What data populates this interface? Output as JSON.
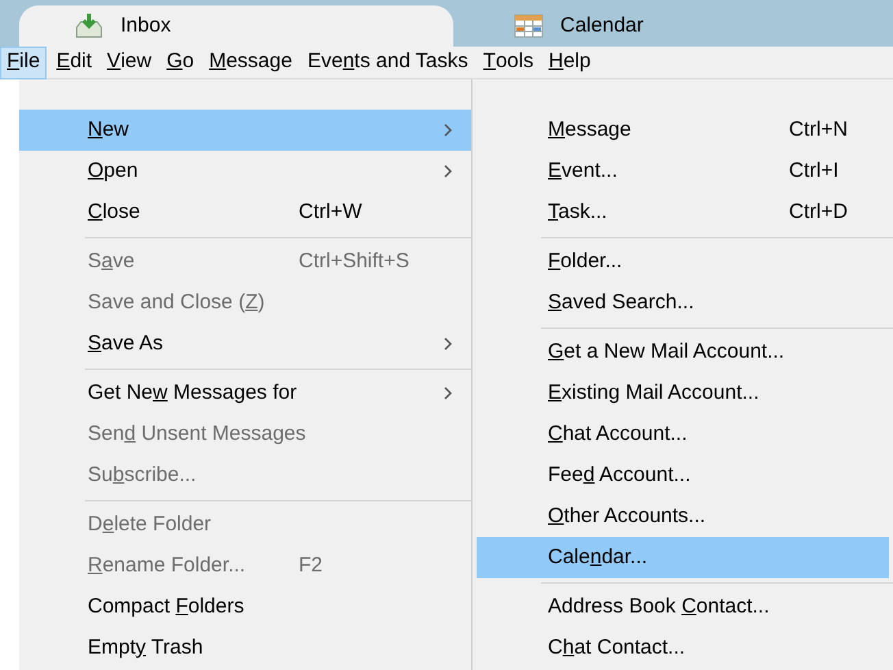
{
  "tabs": [
    {
      "label": "Inbox",
      "selected": true
    },
    {
      "label": "Calendar",
      "selected": false
    }
  ],
  "menubar": [
    {
      "key": "F",
      "post": "ile",
      "selected": true
    },
    {
      "key": "E",
      "post": "dit",
      "selected": false
    },
    {
      "key": "V",
      "post": "iew",
      "selected": false
    },
    {
      "key": "G",
      "post": "o",
      "selected": false
    },
    {
      "key": "M",
      "post": "essage",
      "selected": false
    },
    {
      "pre": "Eve",
      "key": "n",
      "post": "ts and Tasks",
      "selected": false
    },
    {
      "key": "T",
      "post": "ools",
      "selected": false
    },
    {
      "key": "H",
      "post": "elp",
      "selected": false
    }
  ],
  "file_menu": [
    {
      "kind": "item",
      "key": "N",
      "post": "ew",
      "submenu": true,
      "selected": true,
      "disabled": false
    },
    {
      "kind": "item",
      "key": "O",
      "post": "pen",
      "submenu": true,
      "selected": false,
      "disabled": false
    },
    {
      "kind": "item",
      "key": "C",
      "post": "lose",
      "shortcut": "Ctrl+W",
      "submenu": false,
      "selected": false,
      "disabled": false
    },
    {
      "kind": "separator"
    },
    {
      "kind": "item",
      "pre": "S",
      "key": "a",
      "post": "ve",
      "shortcut": "Ctrl+Shift+S",
      "submenu": false,
      "selected": false,
      "disabled": true
    },
    {
      "kind": "item",
      "pre": "Save and Close (",
      "key": "Z",
      "post": ")",
      "submenu": false,
      "selected": false,
      "disabled": true
    },
    {
      "kind": "item",
      "key": "S",
      "post": "ave As",
      "submenu": true,
      "selected": false,
      "disabled": false
    },
    {
      "kind": "separator"
    },
    {
      "kind": "item",
      "pre": "Get Ne",
      "key": "w",
      "post": " Messages for",
      "submenu": true,
      "selected": false,
      "disabled": false
    },
    {
      "kind": "item",
      "pre": "Sen",
      "key": "d",
      "post": " Unsent Messages",
      "submenu": false,
      "selected": false,
      "disabled": true
    },
    {
      "kind": "item",
      "pre": "Su",
      "key": "b",
      "post": "scribe...",
      "submenu": false,
      "selected": false,
      "disabled": true
    },
    {
      "kind": "separator"
    },
    {
      "kind": "item",
      "pre": "D",
      "key": "e",
      "post": "lete Folder",
      "submenu": false,
      "selected": false,
      "disabled": true
    },
    {
      "kind": "item",
      "key": "R",
      "post": "ename Folder...",
      "shortcut": "F2",
      "submenu": false,
      "selected": false,
      "disabled": true
    },
    {
      "kind": "item",
      "pre": "Compact ",
      "key": "F",
      "post": "olders",
      "submenu": false,
      "selected": false,
      "disabled": false
    },
    {
      "kind": "item",
      "pre": "Empt",
      "key": "y",
      "post": " Trash",
      "submenu": false,
      "selected": false,
      "disabled": false
    }
  ],
  "new_submenu": [
    {
      "kind": "item",
      "key": "M",
      "post": "essage",
      "shortcut": "Ctrl+N",
      "selected": false
    },
    {
      "kind": "item",
      "key": "E",
      "post": "vent...",
      "shortcut": "Ctrl+I",
      "selected": false
    },
    {
      "kind": "item",
      "key": "T",
      "post": "ask...",
      "shortcut": "Ctrl+D",
      "selected": false
    },
    {
      "kind": "separator"
    },
    {
      "kind": "item",
      "key": "F",
      "post": "older...",
      "selected": false
    },
    {
      "kind": "item",
      "key": "S",
      "post": "aved Search...",
      "selected": false
    },
    {
      "kind": "separator"
    },
    {
      "kind": "item",
      "key": "G",
      "post": "et a New Mail Account...",
      "selected": false
    },
    {
      "kind": "item",
      "key": "E",
      "post": "xisting Mail Account...",
      "selected": false
    },
    {
      "kind": "item",
      "key": "C",
      "post": "hat Account...",
      "selected": false
    },
    {
      "kind": "item",
      "pre": "Fee",
      "key": "d",
      "post": " Account...",
      "selected": false
    },
    {
      "kind": "item",
      "key": "O",
      "post": "ther Accounts...",
      "selected": false
    },
    {
      "kind": "item",
      "pre": "Cale",
      "key": "n",
      "post": "dar...",
      "selected": true
    },
    {
      "kind": "separator"
    },
    {
      "kind": "item",
      "pre": "Address Book ",
      "key": "C",
      "post": "ontact...",
      "selected": false
    },
    {
      "kind": "item",
      "pre": "C",
      "key": "h",
      "post": "at Contact...",
      "selected": false
    }
  ]
}
